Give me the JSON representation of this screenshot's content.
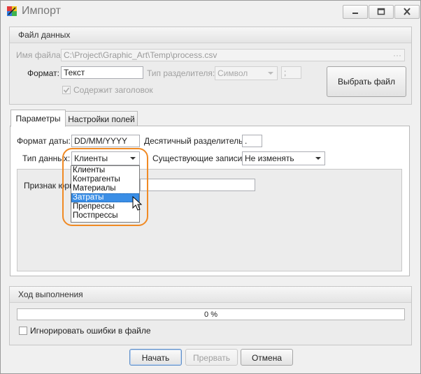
{
  "window": {
    "title": "Импорт",
    "controls": [
      "minimize-icon",
      "maximize-icon",
      "close-icon"
    ]
  },
  "data_file": {
    "group_title": "Файл данных",
    "file_name_label": "Имя файла:",
    "file_name_value": "C:\\Project\\Graphic_Art\\Temp\\process.csv",
    "browse_ellipsis": "···",
    "format_label": "Формат:",
    "format_value": "Текст",
    "separator_type_label": "Тип разделителя:",
    "separator_type_value": "Символ",
    "separator_char": ";",
    "has_header_label": "Содержит заголовок",
    "has_header_checked": true,
    "choose_file_button": "Выбрать файл"
  },
  "tabs": [
    {
      "label": "Параметры",
      "active": true
    },
    {
      "label": "Настройки полей",
      "active": false
    }
  ],
  "params": {
    "date_format_label": "Формат даты:",
    "date_format_value": "DD/MM/YYYY",
    "decimal_sep_label": "Десятичный разделитель:",
    "decimal_sep_value": ".",
    "data_type_label": "Тип данных:",
    "data_type_value": "Клиенты",
    "existing_records_label": "Существующие записи:",
    "existing_records_value": "Не изменять",
    "legal_sign_label": "Признак юри",
    "legal_sign_value": ""
  },
  "data_type_dropdown": {
    "options": [
      "Клиенты",
      "Контрагенты",
      "Материалы",
      "Затраты",
      "Препрессы",
      "Постпрессы"
    ],
    "selected_index": 3
  },
  "progress": {
    "group_title": "Ход выполнения",
    "percent_text": "0 %",
    "value": 0,
    "ignore_errors_label": "Игнорировать ошибки в файле",
    "ignore_errors_checked": false
  },
  "footer": {
    "start_button": "Начать",
    "abort_button": "Прервать",
    "cancel_button": "Отмена"
  },
  "colors": {
    "accent_selection": "#3a8ee6",
    "highlight_ring": "#f08a24",
    "progress_fill": "#9bd18c"
  }
}
